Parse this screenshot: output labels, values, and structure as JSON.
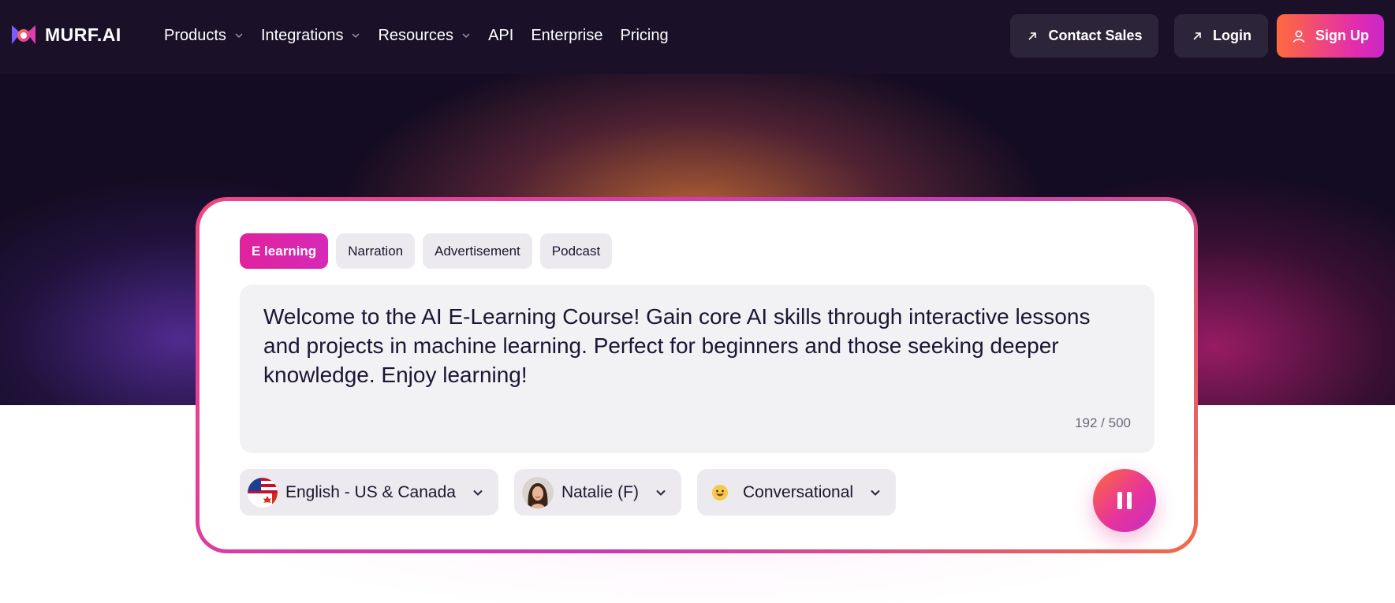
{
  "brand": {
    "name": "MURF.AI"
  },
  "nav": {
    "items": [
      {
        "label": "Products",
        "dropdown": true
      },
      {
        "label": "Integrations",
        "dropdown": true
      },
      {
        "label": "Resources",
        "dropdown": true
      },
      {
        "label": "API",
        "dropdown": false
      },
      {
        "label": "Enterprise",
        "dropdown": false
      },
      {
        "label": "Pricing",
        "dropdown": false
      }
    ],
    "contact_sales": "Contact Sales",
    "login": "Login",
    "sign_up": "Sign Up"
  },
  "demo": {
    "tabs": [
      "E learning",
      "Narration",
      "Advertisement",
      "Podcast"
    ],
    "active_tab": "E learning",
    "text": "Welcome to the AI E-Learning Course! Gain core AI skills through interactive lessons and projects in machine learning. Perfect for beginners and those seeking deeper knowledge. Enjoy learning!",
    "counter": "192 / 500",
    "language": "English - US & Canada",
    "voice": "Natalie (F)",
    "style": "Conversational",
    "play_state": "pause-icon"
  },
  "colors": {
    "accent_pink": "#e0229d",
    "signup_gradient_start": "#ff6a3d",
    "signup_gradient_end": "#c827c9",
    "nav_bg": "#1a1128"
  }
}
